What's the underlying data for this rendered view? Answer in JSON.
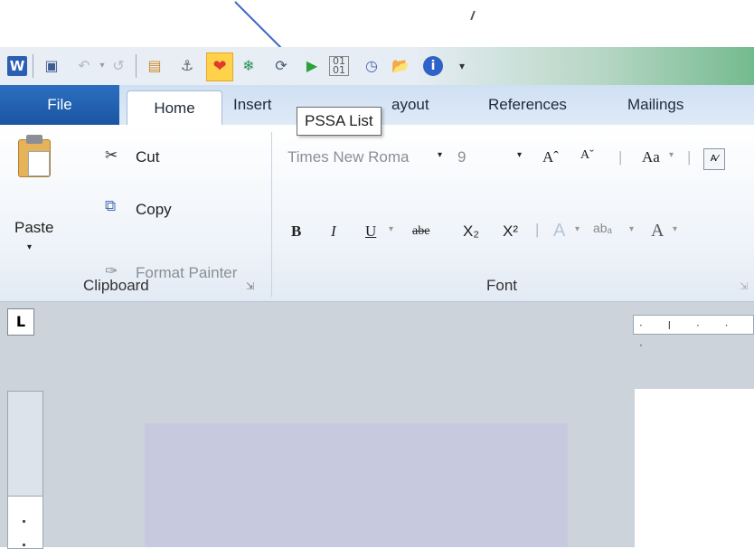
{
  "tooltip": {
    "text": "PSSA List"
  },
  "tabs": {
    "file": "File",
    "home": "Home",
    "insert": "Insert",
    "page_layout_partial": "ayout",
    "references": "References",
    "mailings": "Mailings"
  },
  "clipboard": {
    "paste": "Paste",
    "cut": "Cut",
    "copy": "Copy",
    "format_painter": "Format Painter",
    "group_label": "Clipboard"
  },
  "font": {
    "font_name": "Times New Romа",
    "font_size": "9",
    "grow": "Aˆ",
    "shrink": "Aˇ",
    "change_case": "Aa",
    "bold": "B",
    "italic": "I",
    "underline": "U",
    "strike": "abe",
    "subscript": "X₂",
    "superscript": "X²",
    "text_effects": "A",
    "highlight": "abₐ",
    "font_color": "A",
    "group_label": "Font"
  },
  "ruler": {
    "tab_selector": "L",
    "marks": "· I · · ·"
  },
  "icons": [
    "word-logo-icon",
    "save-icon",
    "undo-icon",
    "redo-icon",
    "new-icon",
    "anchor-icon",
    "pssa-heart-icon",
    "snowflake-icon",
    "refresh-icon",
    "run-icon",
    "binary-icon",
    "clock-icon",
    "folder-icon",
    "info-icon",
    "customize-qat-icon"
  ],
  "colors": {
    "file_tab": "#2c6fbf",
    "arrow": "#3f6cc4",
    "qat_highlight": "#ffd24a"
  }
}
